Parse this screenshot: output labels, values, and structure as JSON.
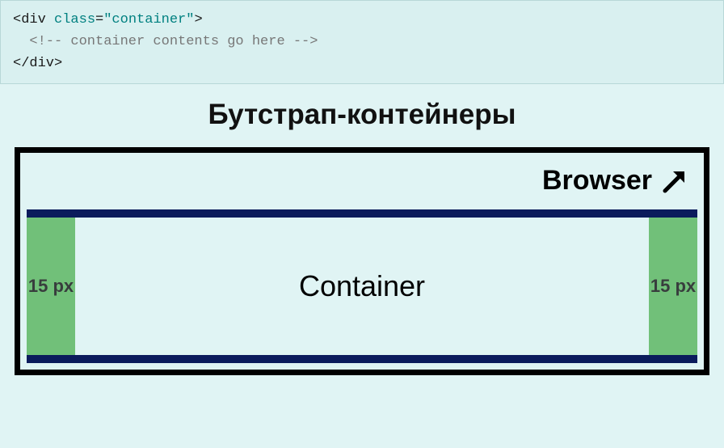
{
  "code": {
    "line1_open": "<div ",
    "line1_class_attr": "class",
    "line1_equals": "=",
    "line1_class_value": "\"container\"",
    "line1_close": ">",
    "line2": "<!-- container contents go here -->",
    "line3": "</div>"
  },
  "heading": "Бутстрап-контейнеры",
  "diagram": {
    "browser_label": "Browser",
    "container_label": "Container",
    "padding_left": "15 px",
    "padding_right": "15 px"
  }
}
